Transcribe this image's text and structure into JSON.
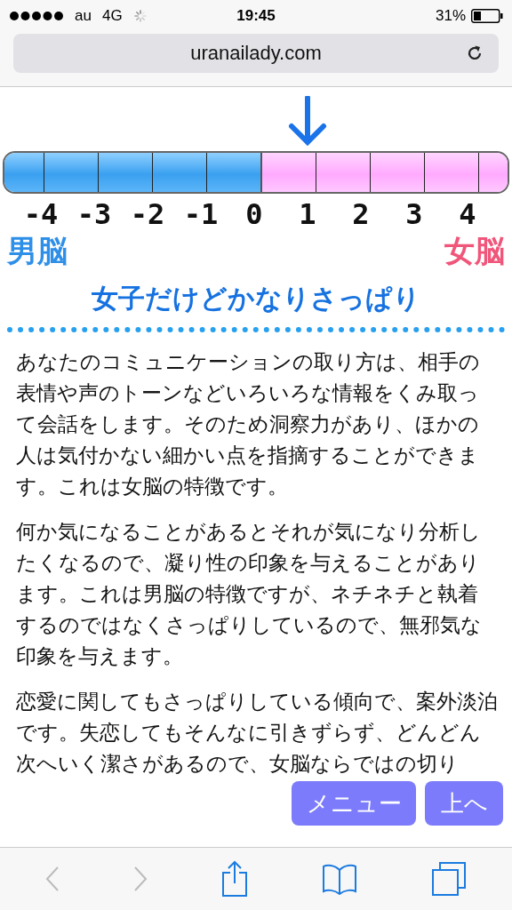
{
  "status_bar": {
    "carrier": "au",
    "network": "4G",
    "time": "19:45",
    "battery": "31%"
  },
  "address_bar": {
    "url": "uranailady.com"
  },
  "gauge": {
    "ticks": [
      {
        "label": "-4",
        "selected": false
      },
      {
        "label": "-3",
        "selected": false
      },
      {
        "label": "-2",
        "selected": false
      },
      {
        "label": "-1",
        "selected": false
      },
      {
        "label": "0",
        "selected": false
      },
      {
        "label": "1",
        "selected": true
      },
      {
        "label": "2",
        "selected": false
      },
      {
        "label": "3",
        "selected": false
      },
      {
        "label": "4",
        "selected": false
      }
    ],
    "left_label": "男脳",
    "right_label": "女脳"
  },
  "heading": "女子だけどかなりさっぱり",
  "paragraphs": [
    "あなたのコミュニケーションの取り方は、相手の表情や声のトーンなどいろいろな情報をくみ取って会話をします。そのため洞察力があり、ほかの人は気付かない細かい点を指摘することができます。これは女脳の特徴です。",
    "何か気になることがあるとそれが気になり分析したくなるので、凝り性の印象を与えることがあります。これは男脳の特徴ですが、ネチネチと執着するのではなくさっぱりしているので、無邪気な印象を与えます。",
    "恋愛に関してもさっぱりしている傾向で、案外淡泊です。失恋してもそんなに引きずらず、どんどん次へいく潔さがあるので、女脳ならではの切り"
  ],
  "floating_buttons": [
    "メニュー",
    "上へ"
  ]
}
